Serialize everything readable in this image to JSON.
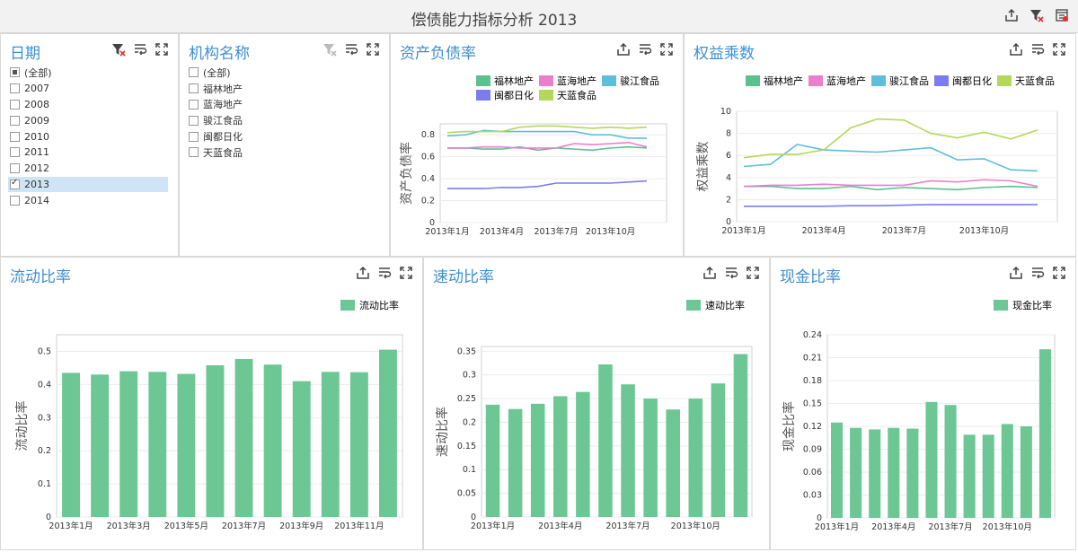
{
  "header": {
    "title": "偿债能力指标分析  2013"
  },
  "date_filter": {
    "title": "日期",
    "items": [
      {
        "label": "(全部)",
        "state": "partial"
      },
      {
        "label": "2007",
        "state": "unchecked"
      },
      {
        "label": "2008",
        "state": "unchecked"
      },
      {
        "label": "2009",
        "state": "unchecked"
      },
      {
        "label": "2010",
        "state": "unchecked"
      },
      {
        "label": "2011",
        "state": "unchecked"
      },
      {
        "label": "2012",
        "state": "unchecked"
      },
      {
        "label": "2013",
        "state": "checked"
      },
      {
        "label": "2014",
        "state": "unchecked"
      }
    ]
  },
  "org_filter": {
    "title": "机构名称",
    "items": [
      {
        "label": "(全部)",
        "state": "unchecked"
      },
      {
        "label": "福林地产",
        "state": "unchecked"
      },
      {
        "label": "蓝海地产",
        "state": "unchecked"
      },
      {
        "label": "骏江食品",
        "state": "unchecked"
      },
      {
        "label": "闽都日化",
        "state": "unchecked"
      },
      {
        "label": "天蓝食品",
        "state": "unchecked"
      }
    ]
  },
  "panels": {
    "debt_ratio": "资产负债率",
    "equity_mult": "权益乘数",
    "current_ratio": "流动比率",
    "quick_ratio": "速动比率",
    "cash_ratio": "现金比率"
  },
  "colors": {
    "福林地产": "#5cc08f",
    "蓝海地产": "#ea7fcd",
    "骏江食品": "#5ebedb",
    "闽都日化": "#7b7cf0",
    "天蓝食品": "#b5d85a",
    "bar": "#6cc795"
  },
  "chart_data": [
    {
      "id": "debt_ratio",
      "type": "line",
      "ylabel": "资产负债率",
      "ylim": [
        0,
        0.9
      ],
      "yticks": [
        "0",
        "0.2",
        "0.4",
        "0.6",
        "0.8"
      ],
      "xticks": [
        "2013年1月",
        "2013年4月",
        "2013年7月",
        "2013年10月"
      ],
      "series": [
        {
          "name": "福林地产",
          "values": [
            0.68,
            0.68,
            0.67,
            0.67,
            0.69,
            0.66,
            0.68,
            0.67,
            0.66,
            0.68,
            0.69,
            0.68
          ]
        },
        {
          "name": "蓝海地产",
          "values": [
            0.68,
            0.68,
            0.69,
            0.69,
            0.68,
            0.68,
            0.68,
            0.72,
            0.71,
            0.72,
            0.73,
            0.69
          ]
        },
        {
          "name": "骏江食品",
          "values": [
            0.79,
            0.8,
            0.84,
            0.83,
            0.83,
            0.83,
            0.83,
            0.83,
            0.8,
            0.8,
            0.77,
            0.77
          ]
        },
        {
          "name": "闽都日化",
          "values": [
            0.31,
            0.31,
            0.31,
            0.32,
            0.32,
            0.33,
            0.36,
            0.36,
            0.36,
            0.36,
            0.37,
            0.38
          ]
        },
        {
          "name": "天蓝食品",
          "values": [
            0.82,
            0.83,
            0.83,
            0.83,
            0.87,
            0.88,
            0.88,
            0.87,
            0.86,
            0.87,
            0.86,
            0.87
          ]
        }
      ]
    },
    {
      "id": "equity_mult",
      "type": "line",
      "ylabel": "权益乘数",
      "ylim": [
        0,
        10
      ],
      "yticks": [
        "0",
        "2",
        "4",
        "6",
        "8",
        "10"
      ],
      "xticks": [
        "2013年1月",
        "2013年4月",
        "2013年7月",
        "2013年10月"
      ],
      "series": [
        {
          "name": "福林地产",
          "values": [
            3.2,
            3.2,
            3.0,
            3.0,
            3.2,
            2.9,
            3.1,
            3.0,
            2.9,
            3.1,
            3.2,
            3.1
          ]
        },
        {
          "name": "蓝海地产",
          "values": [
            3.2,
            3.3,
            3.3,
            3.4,
            3.3,
            3.3,
            3.3,
            3.7,
            3.6,
            3.8,
            3.7,
            3.2
          ]
        },
        {
          "name": "骏江食品",
          "values": [
            5.0,
            5.2,
            7.0,
            6.5,
            6.4,
            6.3,
            6.5,
            6.7,
            5.6,
            5.7,
            4.7,
            4.6
          ]
        },
        {
          "name": "闽都日化",
          "values": [
            1.4,
            1.4,
            1.4,
            1.4,
            1.45,
            1.45,
            1.5,
            1.55,
            1.55,
            1.55,
            1.55,
            1.55
          ]
        },
        {
          "name": "天蓝食品",
          "values": [
            5.8,
            6.1,
            6.1,
            6.5,
            8.5,
            9.3,
            9.2,
            8.0,
            7.6,
            8.1,
            7.5,
            8.3
          ]
        }
      ]
    },
    {
      "id": "current_ratio",
      "type": "bar",
      "ylabel": "流动比率",
      "legend": "流动比率",
      "ylim": [
        0,
        0.55
      ],
      "yticks": [
        "0",
        "0.1",
        "0.2",
        "0.3",
        "0.4",
        "0.5"
      ],
      "xticks": [
        "2013年1月",
        "2013年3月",
        "2013年5月",
        "2013年7月",
        "2013年9月",
        "2013年11月"
      ],
      "values": [
        0.435,
        0.43,
        0.44,
        0.438,
        0.432,
        0.458,
        0.477,
        0.46,
        0.41,
        0.438,
        0.437,
        0.505
      ]
    },
    {
      "id": "quick_ratio",
      "type": "bar",
      "ylabel": "速动比率",
      "legend": "速动比率",
      "ylim": [
        0,
        0.36
      ],
      "yticks": [
        "0",
        "0.05",
        "0.1",
        "0.15",
        "0.2",
        "0.25",
        "0.3",
        "0.35"
      ],
      "xticks": [
        "2013年1月",
        "2013年4月",
        "2013年7月",
        "2013年10月"
      ],
      "values": [
        0.237,
        0.228,
        0.239,
        0.255,
        0.264,
        0.322,
        0.28,
        0.25,
        0.227,
        0.25,
        0.282,
        0.344
      ]
    },
    {
      "id": "cash_ratio",
      "type": "bar",
      "ylabel": "现金比率",
      "legend": "现金比率",
      "ylim": [
        0,
        0.24
      ],
      "yticks": [
        "0",
        "0.03",
        "0.06",
        "0.09",
        "0.12",
        "0.15",
        "0.18",
        "0.21",
        "0.24"
      ],
      "xticks": [
        "2013年1月",
        "2013年4月",
        "2013年7月",
        "2013年10月"
      ],
      "values": [
        0.125,
        0.118,
        0.116,
        0.118,
        0.117,
        0.152,
        0.148,
        0.109,
        0.109,
        0.123,
        0.12,
        0.221
      ]
    }
  ]
}
